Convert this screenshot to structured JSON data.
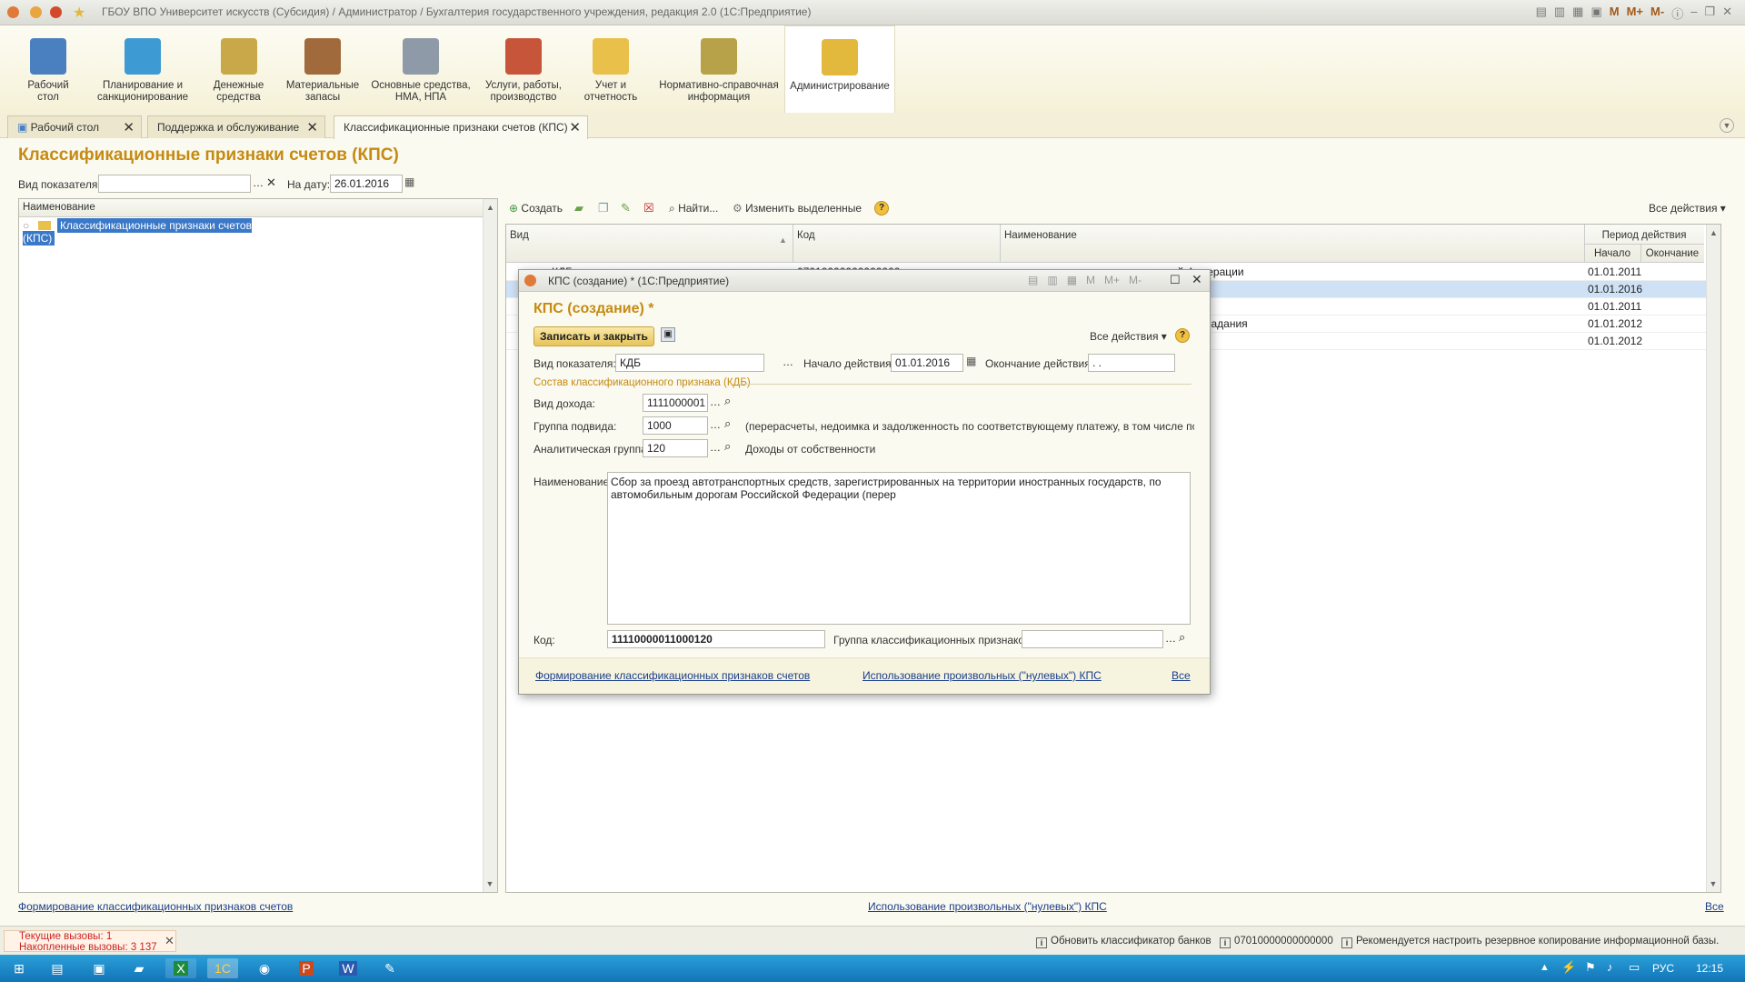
{
  "window": {
    "title": "ГБОУ ВПО Университет искусств (Субсидия) / Администратор / Бухгалтерия государственного учреждения, редакция 2.0  (1С:Предприятие)",
    "controls": [
      "M",
      "M+",
      "M-"
    ]
  },
  "sections": [
    {
      "label": "Рабочий стол",
      "icon": "desktop-icon",
      "color": "#4a7fc0"
    },
    {
      "label": "Планирование и санкционирование",
      "icon": "planning-icon",
      "color": "#3d9ad2"
    },
    {
      "label": "Денежные средства",
      "icon": "coins-icon",
      "color": "#c9a84a"
    },
    {
      "label": "Материальные запасы",
      "icon": "boxes-icon",
      "color": "#a06a3c"
    },
    {
      "label": "Основные средства, НМА, НПА",
      "icon": "truck-icon",
      "color": "#8f9aa8"
    },
    {
      "label": "Услуги, работы, производство",
      "icon": "toolbox-icon",
      "color": "#c7553a"
    },
    {
      "label": "Учет и отчетность",
      "icon": "folder-icon",
      "color": "#e8c04a"
    },
    {
      "label": "Нормативно-справочная информация",
      "icon": "binders-icon",
      "color": "#b7a24a"
    },
    {
      "label": "Администрирование",
      "icon": "admin-icon",
      "color": "#e2b93c"
    }
  ],
  "tabs": [
    {
      "label": "Рабочий стол"
    },
    {
      "label": "Поддержка и обслуживание"
    },
    {
      "label": "Классификационные признаки счетов (КПС)"
    }
  ],
  "page": {
    "title": "Классификационные признаки счетов (КПС)",
    "vid_label": "Вид показателя:",
    "vid_value": "",
    "date_label": "На дату:",
    "date_value": "26.01.2016"
  },
  "tree": {
    "header": "Наименование",
    "item": "Классификационные признаки счетов (КПС)"
  },
  "toolbar": {
    "create": "Создать",
    "find": "Найти...",
    "change": "Изменить выделенные",
    "all_actions": "Все действия"
  },
  "grid": {
    "columns": {
      "vid": "Вид",
      "kod": "Код",
      "name": "Наименование",
      "period": "Период действия",
      "start": "Начало",
      "end": "Окончание"
    },
    "rows": [
      {
        "vid": "КДБ",
        "kod": "07010000000000000",
        "name_tail": "ой Федерации",
        "start": "01.01.2011",
        "end": ""
      },
      {
        "vid": "",
        "kod": "",
        "name_tail": "",
        "start": "01.01.2016",
        "end": ""
      },
      {
        "vid": "",
        "kod": "",
        "name_tail": "",
        "start": "01.01.2011",
        "end": ""
      },
      {
        "vid": "",
        "kod": "",
        "name_tail": "задания",
        "start": "01.01.2012",
        "end": ""
      },
      {
        "vid": "",
        "kod": "",
        "name_tail": "",
        "start": "01.01.2012",
        "end": ""
      }
    ]
  },
  "dialog": {
    "title": "КПС (создание) * (1С:Предприятие)",
    "heading": "КПС (создание) *",
    "save_close": "Записать и закрыть",
    "all_actions": "Все действия",
    "vid_label": "Вид показателя:",
    "vid_value": "КДБ",
    "start_label": "Начало действия:",
    "start_value": "01.01.2016",
    "end_label": "Окончание действия:",
    "end_value": " .  . ",
    "group_title": "Состав классификационного признака (КДБ)",
    "income_label": "Вид дохода:",
    "income_value": "1111000001",
    "subgroup_label": "Группа подвида:",
    "subgroup_value": "1000",
    "subgroup_desc": "(перерасчеты, недоимка и задолженность по соответствующему платежу, в том числе по отм...",
    "analytic_label": "Аналитическая группа:",
    "analytic_value": "120",
    "analytic_desc": "Доходы от собственности",
    "name_label": "Наименование:",
    "name_value": "Сбор за проезд автотранспортных средств, зарегистрированных на территории иностранных государств, по автомобильным дорогам Российской Федерации (перер",
    "code_label": "Код:",
    "code_value": "11110000011000120",
    "classgroup_label": "Группа классификационных признаков:",
    "classgroup_value": "",
    "link1": "Формирование классификационных признаков счетов",
    "link2": "Использование произвольных (\"нулевых\") КПС",
    "link_all": "Все"
  },
  "bottom": {
    "link1": "Формирование классификационных признаков счетов",
    "link2": "Использование произвольных (\"нулевых\") КПС",
    "link_all": "Все"
  },
  "status": {
    "current_calls": "Текущие вызовы: 1",
    "accum_calls": "Накопленные вызовы: 3 137",
    "msg1": "Обновить классификатор банков",
    "msg2": "07010000000000000",
    "msg3": "Рекомендуется настроить резервное копирование информационной базы."
  },
  "taskbar": {
    "lang": "РУС",
    "time": "12:15"
  }
}
